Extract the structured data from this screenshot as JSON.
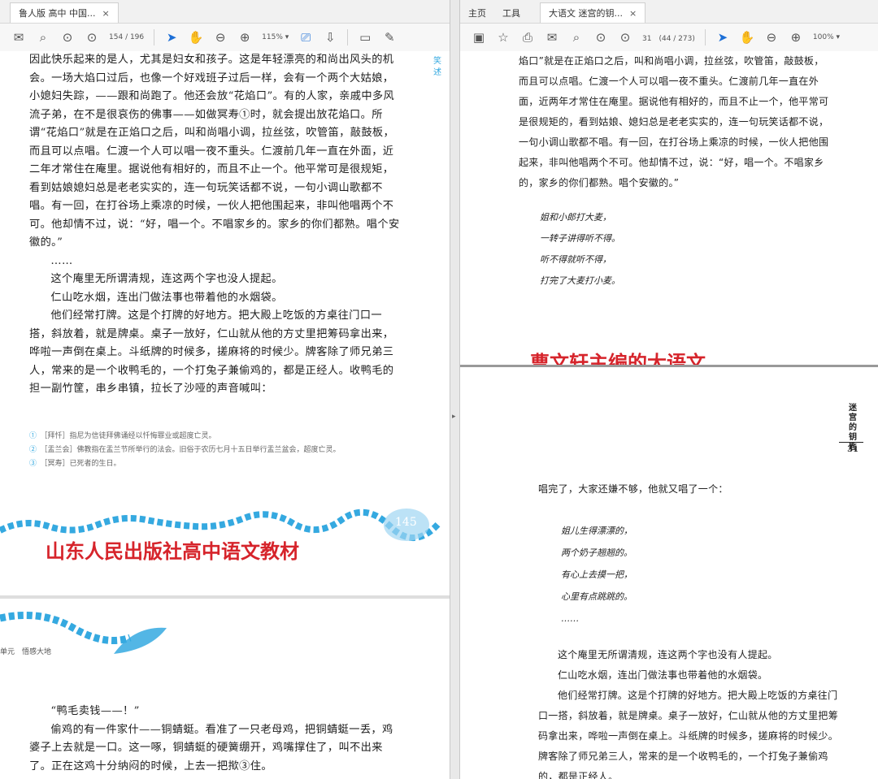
{
  "left": {
    "tab": {
      "title": "鲁人版 高中 中国...",
      "close": "×"
    },
    "toolbar": {
      "page_current": "154",
      "page_sep": "/ 196",
      "zoom": "115%"
    },
    "side_note": "笑述",
    "paragraphs": [
      "因此快乐起来的是人，尤其是妇女和孩子。这是年轻漂亮的和尚出风头的机会。一场大焰口过后，也像一个好戏班子过后一样，会有一个两个大姑娘，小媳妇失踪，——跟和尚跑了。他还会放“花焰口”。有的人家，亲戚中多风流子弟，在不是很哀伤的佛事——如做冥寿①时，就会提出放花焰口。所谓“花焰口”就是在正焰口之后，叫和尚唱小调，拉丝弦，吹管笛，敲鼓板，而且可以点唱。仁渡一个人可以唱一夜不重头。仁渡前几年一直在外面，近二年才常住在庵里。据说他有相好的，而且不止一个。他平常可是很规矩，看到姑娘媳妇总是老老实实的，连一句玩笑话都不说，一句小调山歌都不唱。有一回，在打谷场上乘凉的时候，一伙人把他围起来，非叫他唱两个不可。他却情不过，说：“好，唱一个。不唱家乡的。家乡的你们都熟。唱个安徽的。”"
    ],
    "dots": "……",
    "lines": [
      "这个庵里无所谓清规，连这两个字也没人提起。",
      "仁山吃水烟，连出门做法事也带着他的水烟袋。",
      "他们经常打牌。这是个打牌的好地方。把大殿上吃饭的方桌往门口一搭，斜放着，就是牌桌。桌子一放好，仁山就从他的方丈里把筹码拿出来，哗啦一声倒在桌上。斗纸牌的时候多，搓麻将的时候少。牌客除了师兄弟三人，常来的是一个收鸭毛的，一个打兔子兼偷鸡的，都是正经人。收鸭毛的担一副竹筐，串乡串镇，拉长了沙哑的声音喊叫："
    ],
    "footnotes": [
      {
        "mark": "①",
        "text": "［拜忏］指尼为信徒拜佛诵经以忏悔罪业或超度亡灵。"
      },
      {
        "mark": "②",
        "text": "［盂兰会］佛教指在盂兰节所举行的法会。旧俗于农历七月十五日举行盂兰盆会，超度亡灵。"
      },
      {
        "mark": "③",
        "text": "［冥寿］已死者的生日。"
      }
    ],
    "page_number": "145",
    "caption": "山东人民出版社高中语文教材",
    "next_header": "单元　悟感大地",
    "next_lines": [
      "“鸭毛卖钱——！”",
      "偷鸡的有一件家什——铜蜻蜓。看准了一只老母鸡，把铜蜻蜓一丢，鸡婆子上去就是一口。这一啄，铜蜻蜓的硬簧绷开，鸡嘴撑住了，叫不出来了。正在这鸡十分纳闷的时候，上去一把揿③住。"
    ]
  },
  "right": {
    "tabs": [
      {
        "label": "主页"
      },
      {
        "label": "工具"
      },
      {
        "label": "大语文 迷宫的钥...",
        "close": "×"
      }
    ],
    "toolbar": {
      "page_current": "31",
      "page_sep": "(44 / 273)",
      "zoom": "100%"
    },
    "paragraphs": [
      "焰口”就是在正焰口之后，叫和尚唱小调，拉丝弦，吹管笛，敲鼓板，而且可以点唱。仁渡一个人可以唱一夜不重头。仁渡前几年一直在外面，近两年才常住在庵里。据说他有相好的，而且不止一个，他平常可是很规矩的，看到姑娘、媳妇总是老老实实的，连一句玩笑话都不说，一句小调山歌都不唱。有一回，在打谷场上乘凉的时候，一伙人把他围起来，非叫他唱两个不可。他却情不过，说：“好，唱一个。不唱家乡的，家乡的你们都熟。唱个安徽的。”"
    ],
    "song1": [
      "姐和小郎打大麦，",
      "一转子讲得听不得。",
      "听不得就听不得，",
      "打完了大麦打小麦。"
    ],
    "caption": "曹文轩主编的大语文",
    "vertical_title": "迷宫的钥匙",
    "page_number": "31",
    "p2": "唱完了，大家还嫌不够，他就又唱了一个：",
    "song2": [
      "姐儿生得漂漂的，",
      "两个奶子翘翘的。",
      "有心上去摸一把，",
      "心里有点跳跳的。"
    ],
    "dots": "……",
    "lines": [
      "这个庵里无所谓清规，连这两个字也没有人提起。",
      "仁山吃水烟，连出门做法事也带着他的水烟袋。",
      "他们经常打牌。这是个打牌的好地方。把大殿上吃饭的方桌往门口一搭，斜放着，就是牌桌。桌子一放好，仁山就从他的方丈里把筹码拿出来，哗啦一声倒在桌上。斗纸牌的时候多，搓麻将的时候少。牌客除了师兄弟三人，常来的是一个收鸭毛的，一个打兔子兼偷鸡的，都是正经人。"
    ]
  },
  "colors": {
    "accent_blue": "#1d6fd6",
    "caption_red": "#d6242b",
    "wave_blue": "#35a9e0"
  }
}
